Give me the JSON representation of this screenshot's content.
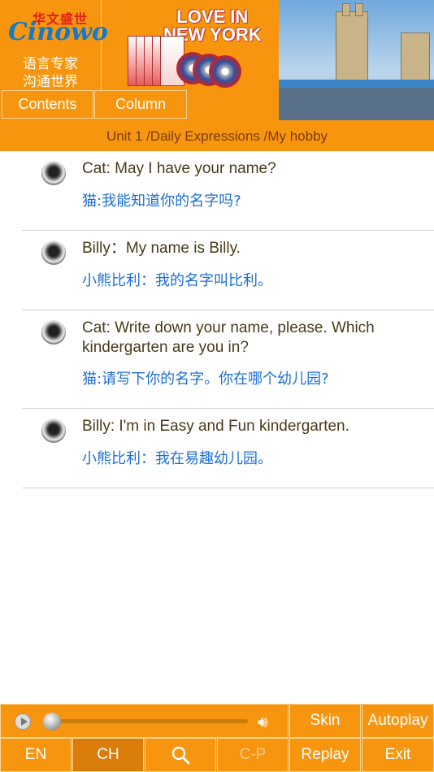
{
  "logo": {
    "top": "华文盛世",
    "word": "Cinowo",
    "line1": "语言专家",
    "line2": "沟通世界"
  },
  "promo": {
    "title_line1": "LOVE IN",
    "title_line2": "NEW YORK"
  },
  "tabs": {
    "contents": "Contents",
    "column": "Column"
  },
  "unit_title": "Unit 1 /Daily Expressions /My hobby",
  "dialogue": [
    {
      "en": "Cat: May I have your name?",
      "cn": "猫:我能知道你的名字吗?"
    },
    {
      "en": "Billy：My name is Billy.",
      "cn": "小熊比利：我的名字叫比利。"
    },
    {
      "en": "Cat: Write down your name, please. Which kindergarten are you in?",
      "cn": "猫:请写下你的名字。你在哪个幼儿园?"
    },
    {
      "en": "Billy: I'm in Easy and Fun kindergarten.",
      "cn": "小熊比利：我在易趣幼儿园。"
    }
  ],
  "toolbar": {
    "skin": "Skin",
    "autoplay": "Autoplay",
    "en": "EN",
    "ch": "CH",
    "cp": "C-P",
    "replay": "Replay",
    "exit": "Exit"
  },
  "colors": {
    "accent": "#F7960E",
    "english_text": "#4a3a1a",
    "chinese_text": "#1d6fd6"
  }
}
